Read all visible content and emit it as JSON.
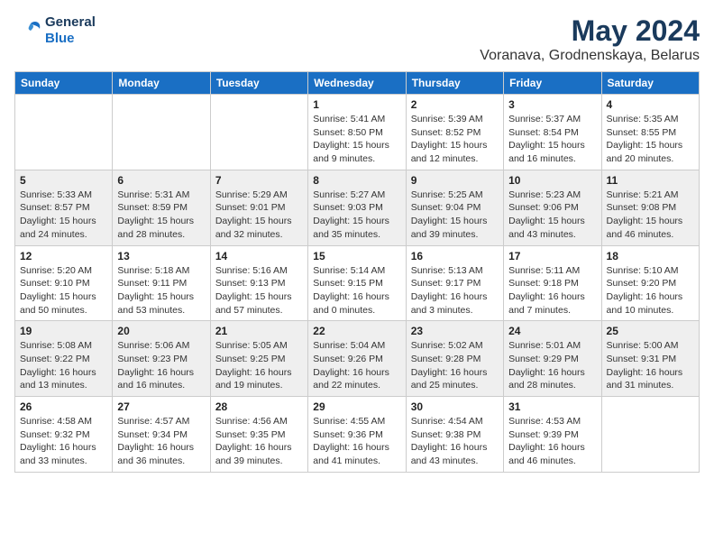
{
  "header": {
    "logo_line1": "General",
    "logo_line2": "Blue",
    "month": "May 2024",
    "location": "Voranava, Grodnenskaya, Belarus"
  },
  "weekdays": [
    "Sunday",
    "Monday",
    "Tuesday",
    "Wednesday",
    "Thursday",
    "Friday",
    "Saturday"
  ],
  "weeks": [
    [
      {
        "day": "",
        "info": ""
      },
      {
        "day": "",
        "info": ""
      },
      {
        "day": "",
        "info": ""
      },
      {
        "day": "1",
        "info": "Sunrise: 5:41 AM\nSunset: 8:50 PM\nDaylight: 15 hours\nand 9 minutes."
      },
      {
        "day": "2",
        "info": "Sunrise: 5:39 AM\nSunset: 8:52 PM\nDaylight: 15 hours\nand 12 minutes."
      },
      {
        "day": "3",
        "info": "Sunrise: 5:37 AM\nSunset: 8:54 PM\nDaylight: 15 hours\nand 16 minutes."
      },
      {
        "day": "4",
        "info": "Sunrise: 5:35 AM\nSunset: 8:55 PM\nDaylight: 15 hours\nand 20 minutes."
      }
    ],
    [
      {
        "day": "5",
        "info": "Sunrise: 5:33 AM\nSunset: 8:57 PM\nDaylight: 15 hours\nand 24 minutes."
      },
      {
        "day": "6",
        "info": "Sunrise: 5:31 AM\nSunset: 8:59 PM\nDaylight: 15 hours\nand 28 minutes."
      },
      {
        "day": "7",
        "info": "Sunrise: 5:29 AM\nSunset: 9:01 PM\nDaylight: 15 hours\nand 32 minutes."
      },
      {
        "day": "8",
        "info": "Sunrise: 5:27 AM\nSunset: 9:03 PM\nDaylight: 15 hours\nand 35 minutes."
      },
      {
        "day": "9",
        "info": "Sunrise: 5:25 AM\nSunset: 9:04 PM\nDaylight: 15 hours\nand 39 minutes."
      },
      {
        "day": "10",
        "info": "Sunrise: 5:23 AM\nSunset: 9:06 PM\nDaylight: 15 hours\nand 43 minutes."
      },
      {
        "day": "11",
        "info": "Sunrise: 5:21 AM\nSunset: 9:08 PM\nDaylight: 15 hours\nand 46 minutes."
      }
    ],
    [
      {
        "day": "12",
        "info": "Sunrise: 5:20 AM\nSunset: 9:10 PM\nDaylight: 15 hours\nand 50 minutes."
      },
      {
        "day": "13",
        "info": "Sunrise: 5:18 AM\nSunset: 9:11 PM\nDaylight: 15 hours\nand 53 minutes."
      },
      {
        "day": "14",
        "info": "Sunrise: 5:16 AM\nSunset: 9:13 PM\nDaylight: 15 hours\nand 57 minutes."
      },
      {
        "day": "15",
        "info": "Sunrise: 5:14 AM\nSunset: 9:15 PM\nDaylight: 16 hours\nand 0 minutes."
      },
      {
        "day": "16",
        "info": "Sunrise: 5:13 AM\nSunset: 9:17 PM\nDaylight: 16 hours\nand 3 minutes."
      },
      {
        "day": "17",
        "info": "Sunrise: 5:11 AM\nSunset: 9:18 PM\nDaylight: 16 hours\nand 7 minutes."
      },
      {
        "day": "18",
        "info": "Sunrise: 5:10 AM\nSunset: 9:20 PM\nDaylight: 16 hours\nand 10 minutes."
      }
    ],
    [
      {
        "day": "19",
        "info": "Sunrise: 5:08 AM\nSunset: 9:22 PM\nDaylight: 16 hours\nand 13 minutes."
      },
      {
        "day": "20",
        "info": "Sunrise: 5:06 AM\nSunset: 9:23 PM\nDaylight: 16 hours\nand 16 minutes."
      },
      {
        "day": "21",
        "info": "Sunrise: 5:05 AM\nSunset: 9:25 PM\nDaylight: 16 hours\nand 19 minutes."
      },
      {
        "day": "22",
        "info": "Sunrise: 5:04 AM\nSunset: 9:26 PM\nDaylight: 16 hours\nand 22 minutes."
      },
      {
        "day": "23",
        "info": "Sunrise: 5:02 AM\nSunset: 9:28 PM\nDaylight: 16 hours\nand 25 minutes."
      },
      {
        "day": "24",
        "info": "Sunrise: 5:01 AM\nSunset: 9:29 PM\nDaylight: 16 hours\nand 28 minutes."
      },
      {
        "day": "25",
        "info": "Sunrise: 5:00 AM\nSunset: 9:31 PM\nDaylight: 16 hours\nand 31 minutes."
      }
    ],
    [
      {
        "day": "26",
        "info": "Sunrise: 4:58 AM\nSunset: 9:32 PM\nDaylight: 16 hours\nand 33 minutes."
      },
      {
        "day": "27",
        "info": "Sunrise: 4:57 AM\nSunset: 9:34 PM\nDaylight: 16 hours\nand 36 minutes."
      },
      {
        "day": "28",
        "info": "Sunrise: 4:56 AM\nSunset: 9:35 PM\nDaylight: 16 hours\nand 39 minutes."
      },
      {
        "day": "29",
        "info": "Sunrise: 4:55 AM\nSunset: 9:36 PM\nDaylight: 16 hours\nand 41 minutes."
      },
      {
        "day": "30",
        "info": "Sunrise: 4:54 AM\nSunset: 9:38 PM\nDaylight: 16 hours\nand 43 minutes."
      },
      {
        "day": "31",
        "info": "Sunrise: 4:53 AM\nSunset: 9:39 PM\nDaylight: 16 hours\nand 46 minutes."
      },
      {
        "day": "",
        "info": ""
      }
    ]
  ]
}
